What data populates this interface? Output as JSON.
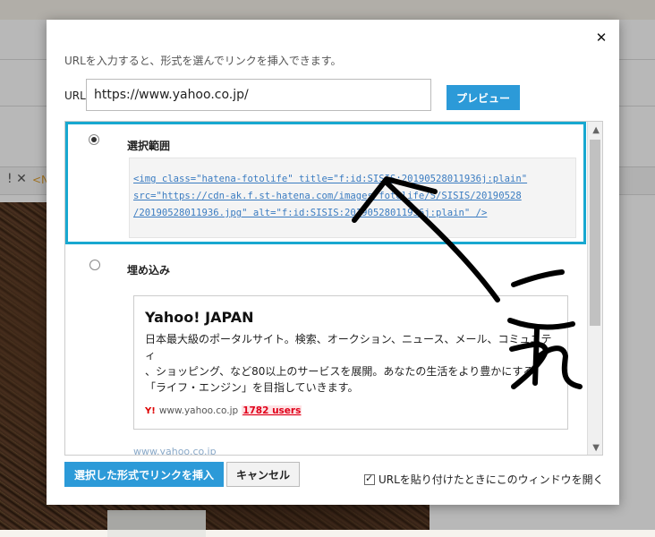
{
  "background": {
    "tab_fragment": "<N"
  },
  "dialog": {
    "intro": "URLを入力すると、形式を選んでリンクを挿入できます。",
    "url_label": "URL",
    "url_value": "https://www.yahoo.co.jp/",
    "preview_label": "プレビュー",
    "options": [
      {
        "title": "選択範囲",
        "selected": true,
        "code_lines": [
          "<img class=\"hatena-fotolife\" title=\"f:id:SISIS:20190528011936j:plain\"",
          "src=\"https://cdn-ak.f.st-hatena.com/images/fotolife/S/SISIS/20190528",
          "/20190528011936.jpg\" alt=\"f:id:SISIS:20190528011936j:plain\" />"
        ]
      },
      {
        "title": "埋め込み",
        "selected": false,
        "embed": {
          "title": "Yahoo! JAPAN",
          "description_lines": [
            "日本最大級のポータルサイト。検索、オークション、ニュース、メール、コミュニティ",
            "、ショッピング、など80以上のサービスを展開。あなたの生活をより豊かにする",
            "「ライフ・エンジン」を目指していきます。"
          ],
          "site": "www.yahoo.co.jp",
          "users": "1782 users",
          "link_text": "www.yahoo.co.jp"
        }
      }
    ],
    "insert_label": "選択した形式でリンクを挿入",
    "cancel_label": "キャンセル",
    "checkbox_label": "URLを貼り付けたときにこのウィンドウを開く",
    "checkbox_checked": true
  },
  "annotation": {
    "handwritten_text": "これ",
    "stroke_color": "#000000"
  },
  "colors": {
    "accent": "#2c9ad8",
    "highlight_border": "#18a8d0",
    "users_red": "#e0001a"
  }
}
